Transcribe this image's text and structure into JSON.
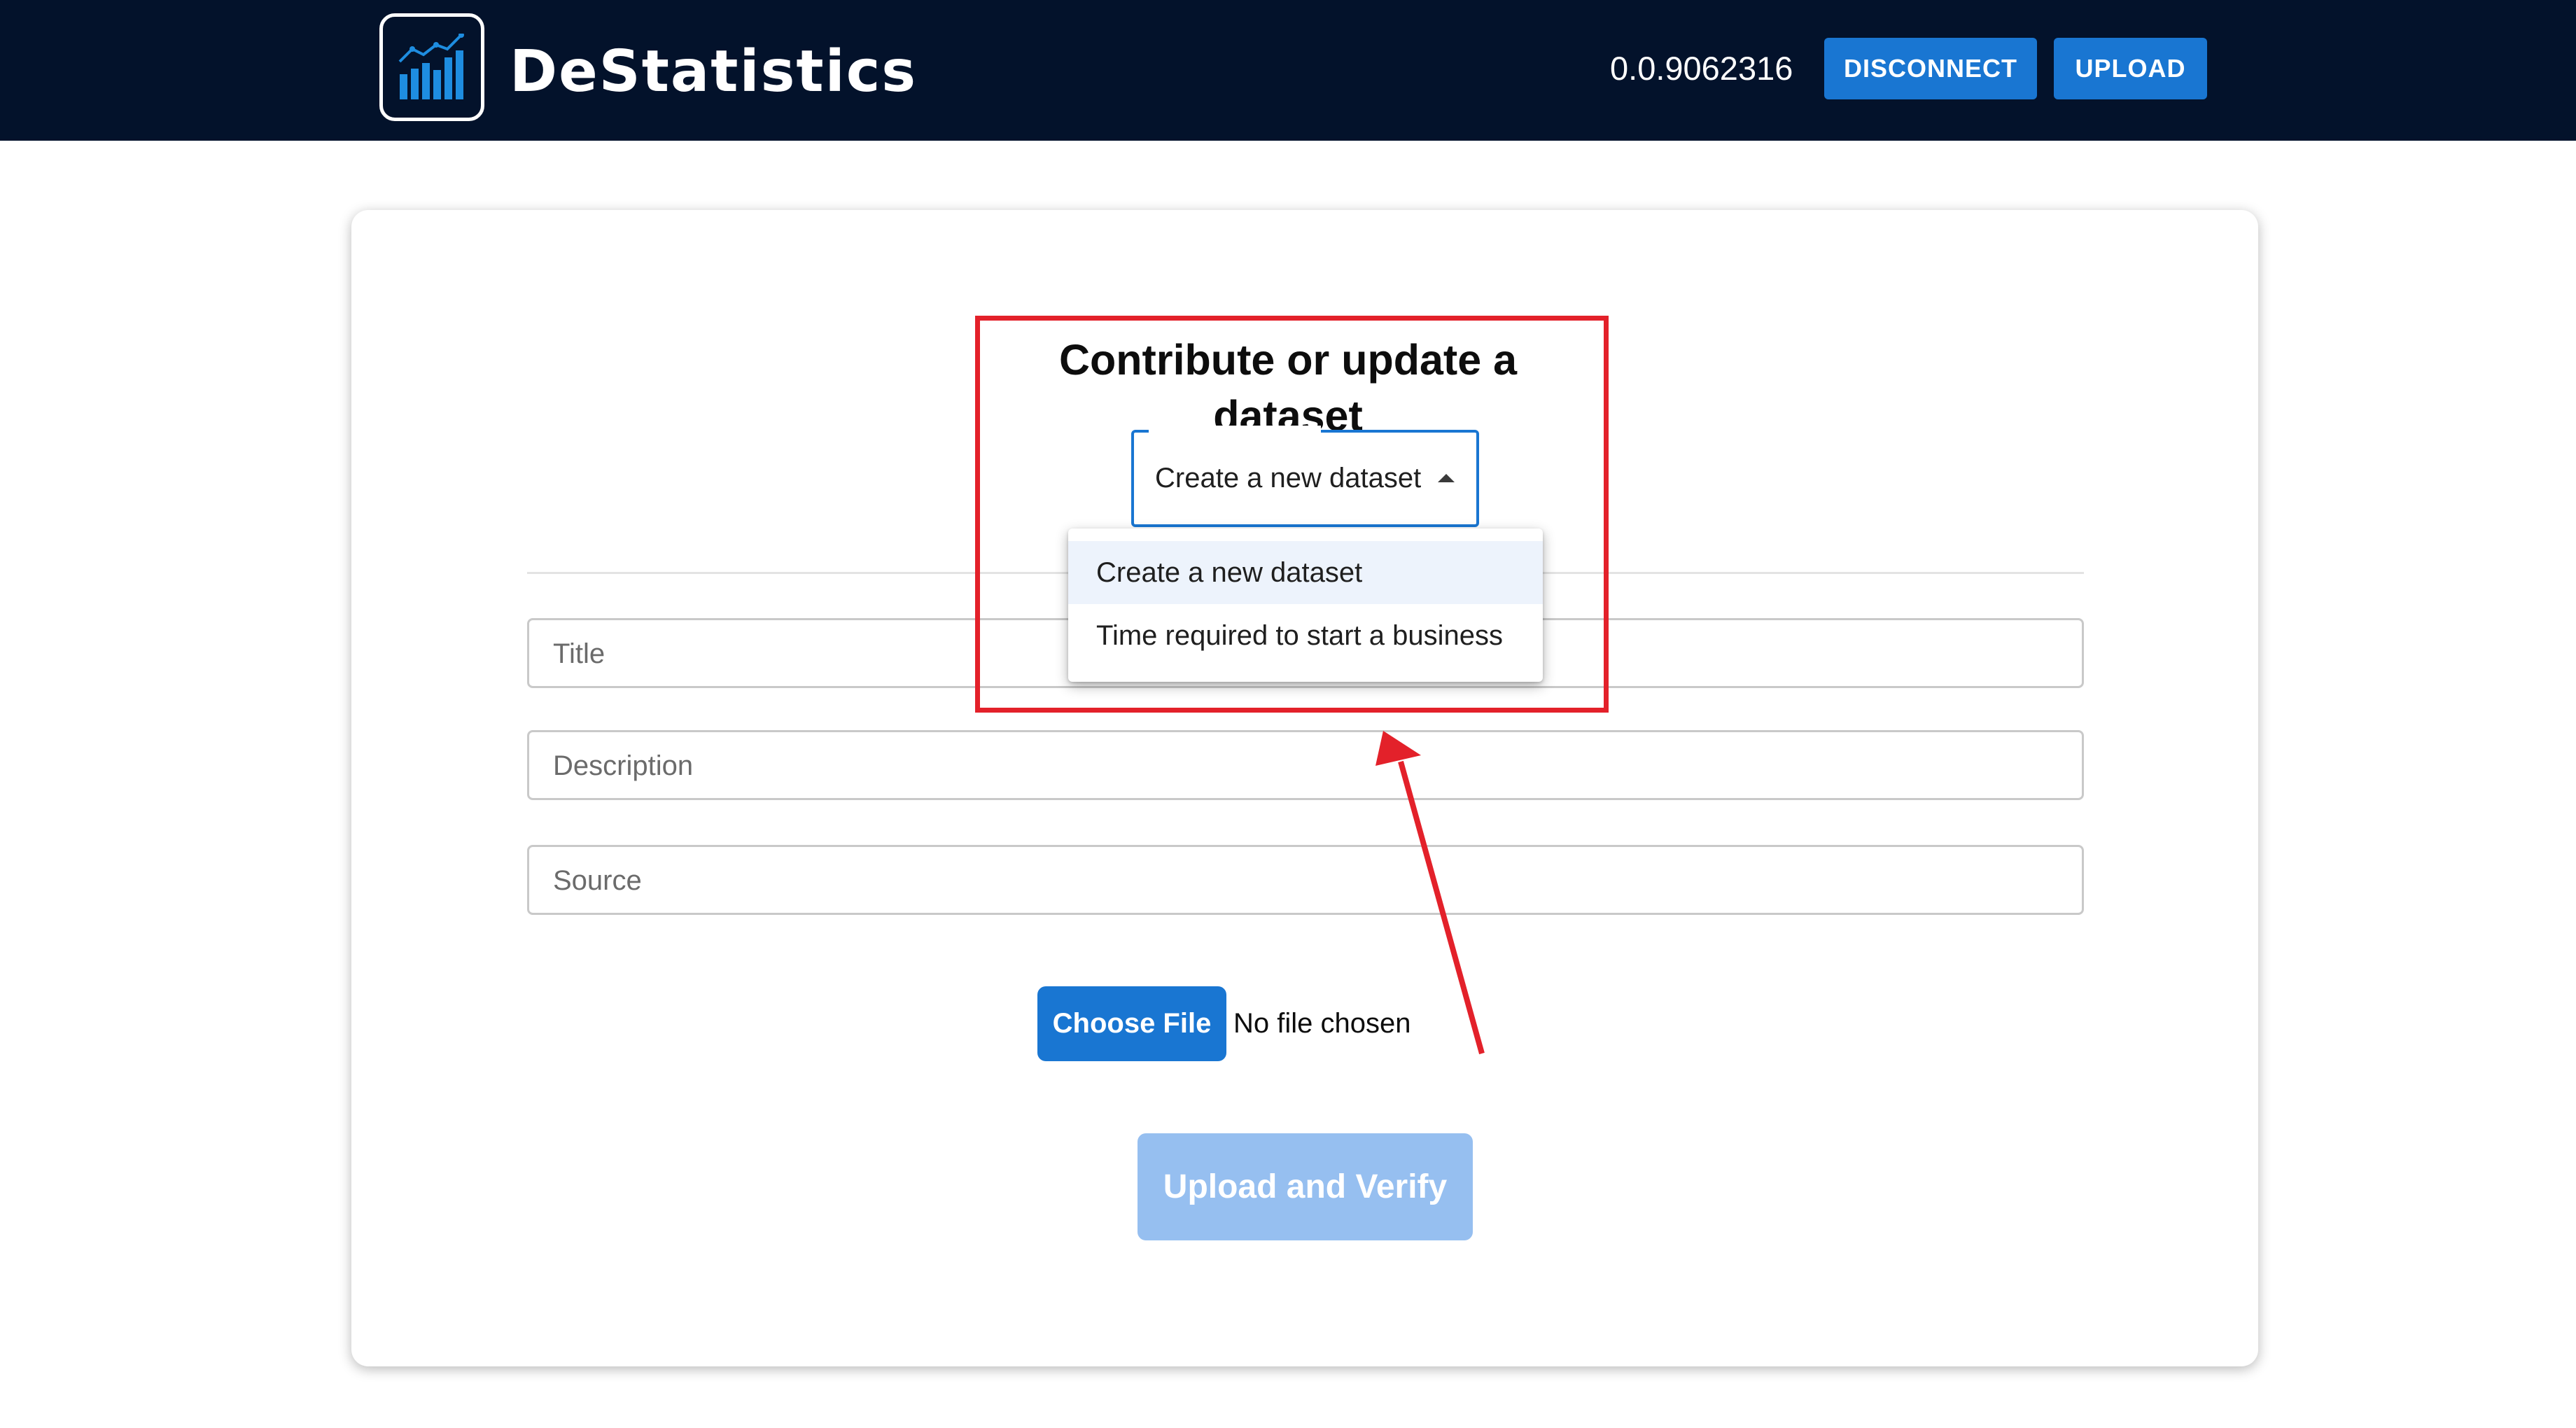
{
  "header": {
    "brand": "DeStatistics",
    "account_id": "0.0.9062316",
    "disconnect_label": "DISCONNECT",
    "upload_label": "UPLOAD",
    "colors": {
      "background": "#03122b",
      "button": "#1976d2"
    },
    "logo_icon": "bar-chart-trend-icon"
  },
  "form": {
    "heading": "Contribute or update a dataset",
    "dataset_select": {
      "value": "Create a new dataset",
      "options": [
        "Create a new dataset",
        "Time required to start a business"
      ]
    },
    "fields": {
      "title_placeholder": "Title",
      "description_placeholder": "Description",
      "source_placeholder": "Source"
    },
    "file": {
      "button_label": "Choose File",
      "status": "No file chosen"
    },
    "submit_label": "Upload and Verify",
    "colors": {
      "primary": "#1976d2",
      "submit_disabled": "#96bff0"
    }
  },
  "annotation": {
    "color": "#e3212a"
  }
}
